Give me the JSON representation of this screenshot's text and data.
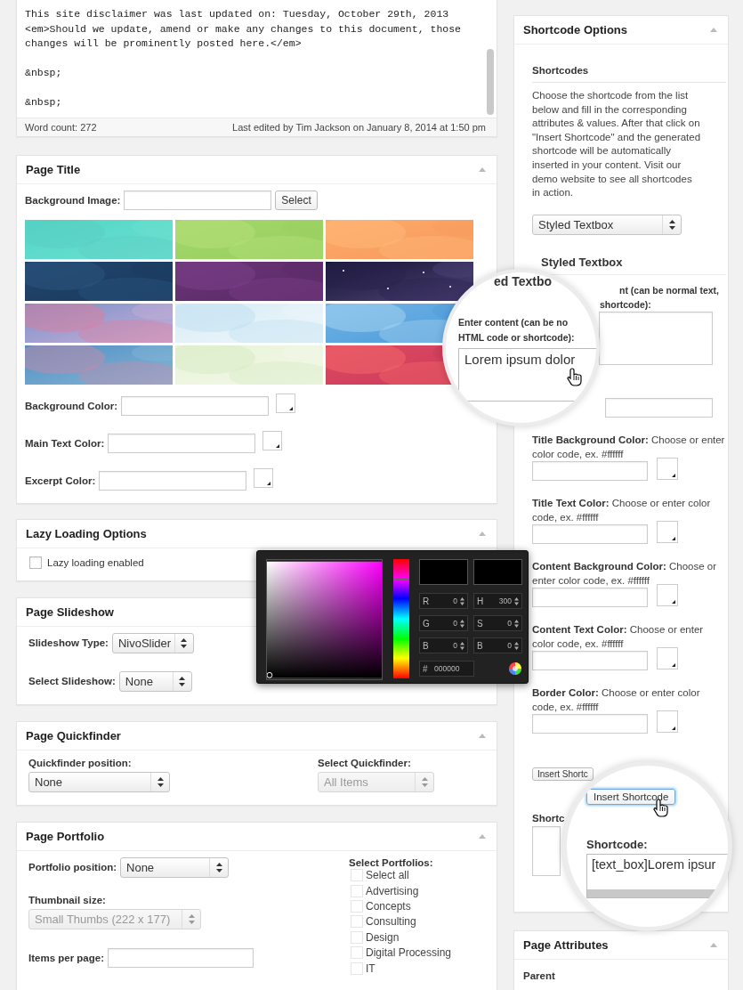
{
  "editor": {
    "paragraphs": [
      [
        "This site disclaimer was last updated on: Tuesday, October 29th, 2013",
        "<em>Should we update, amend or make any changes to this document, those",
        "changes will be prominently posted here.</em>"
      ],
      [
        "&nbsp;"
      ],
      [
        "&nbsp;"
      ]
    ],
    "word_count": "Word count: 272",
    "last_edited": "Last edited by Tim Jackson on January 8, 2014 at 1:50 pm"
  },
  "page_title": {
    "title": "Page Title",
    "background_image": {
      "label": "Background Image:",
      "button": "Select"
    },
    "color_fields": [
      {
        "label": "Background Color:"
      },
      {
        "label": "Main Text Color:"
      },
      {
        "label": "Excerpt Color:"
      }
    ]
  },
  "lazy_loading": {
    "title": "Lazy Loading Options",
    "checkbox": {
      "label": "Lazy loading enabled",
      "checked": false
    }
  },
  "slideshow": {
    "title": "Page Slideshow",
    "fields": [
      {
        "label": "Slideshow Type:",
        "value": "NivoSlider"
      },
      {
        "label": "Select Slideshow:",
        "value": "None"
      }
    ]
  },
  "quickfinder": {
    "title": "Page Quickfinder",
    "fields": [
      {
        "label": "Quickfinder position:",
        "value": "None",
        "disabled": false
      },
      {
        "label": "Select Quickfinder:",
        "value": "All Items",
        "disabled": true
      }
    ]
  },
  "portfolio": {
    "title": "Page Portfolio",
    "position": {
      "label": "Portfolio position:",
      "value": "None"
    },
    "thumbnail": {
      "label": "Thumbnail size:",
      "value": "Small Thumbs (222 x 177)",
      "disabled": true
    },
    "items_per_page": {
      "label": "Items per page:"
    },
    "select_portfolios": {
      "label": "Select Portfolios:",
      "options": [
        {
          "label": "Select all",
          "checked": false
        },
        {
          "label": "Advertising",
          "checked": false
        },
        {
          "label": "Concepts",
          "checked": false
        },
        {
          "label": "Consulting",
          "checked": false
        },
        {
          "label": "Design",
          "checked": false
        },
        {
          "label": "Digital Processing",
          "checked": false
        },
        {
          "label": "IT",
          "checked": false
        }
      ]
    }
  },
  "shortcode_options": {
    "title": "Shortcode Options",
    "section_title": "Shortcodes",
    "description": "Choose the shortcode from the list below and fill in the corresponding attributes & values. After that click on \"Insert Shortcode\" and the generated shortcode will be automatically inserted in your content. Visit our demo website to see all shortcodes in action.",
    "select": {
      "value": "Styled Textbox"
    },
    "heading": "Styled Textbox",
    "content_label_fragments": [
      "nt (can be normal text,",
      "shortcode):"
    ],
    "color_fields": [
      {
        "label": "**Title Background Color:** Choose or enter color code, ex. #ffffff"
      },
      {
        "label": "**Title Text Color:** Choose or enter color code, ex. #ffffff"
      },
      {
        "label": "**Content Background Color:** Choose or enter color code, ex. #ffffff"
      },
      {
        "label": "**Content Text Color:** Choose or enter color code, ex. #ffffff"
      },
      {
        "label": "**Border Color:** Choose or enter color code, ex. #ffffff"
      }
    ],
    "insert_button": "Insert Shortc",
    "shortcode_label": "Shortc"
  },
  "page_attributes": {
    "title": "Page Attributes",
    "parent": "Parent"
  },
  "magnifier_content": {
    "heading": "ed Textbo",
    "label_lines": [
      "Enter content (can be no",
      "HTML code or shortcode):"
    ],
    "value": "Lorem ipsum dolor"
  },
  "magnifier_shortcode": {
    "button": "Insert Shortcode",
    "label": "Shortcode:",
    "value": "[text_box]Lorem ipsur"
  },
  "color_picker": {
    "hue_slider": {
      "level": 0.17
    },
    "channels": [
      {
        "label": "R",
        "value": "0"
      },
      {
        "label": "H",
        "value": "300"
      },
      {
        "label": "G",
        "value": "0"
      },
      {
        "label": "S",
        "value": "0"
      },
      {
        "label": "B",
        "value": "0"
      },
      {
        "label": "B",
        "value": "0"
      }
    ],
    "hex_label": "#",
    "hex": "000000"
  }
}
